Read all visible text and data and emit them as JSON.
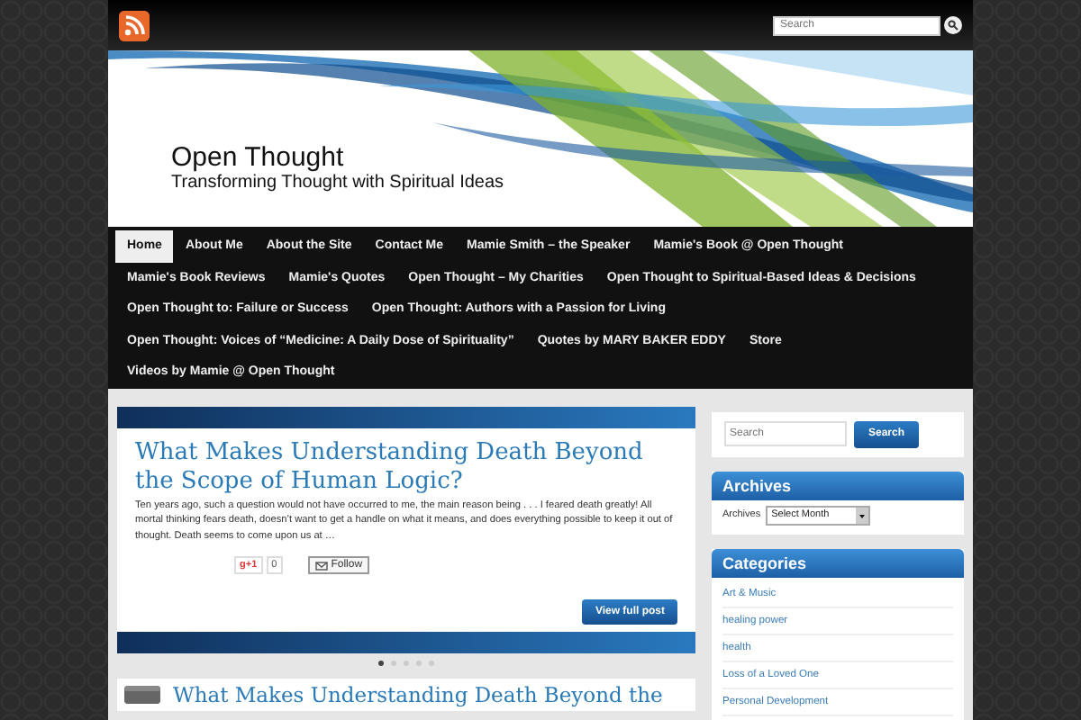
{
  "top_bar": {
    "search": {
      "placeholder": "Search"
    }
  },
  "header": {
    "title": "Open Thought",
    "tagline": "Transforming Thought with Spiritual Ideas"
  },
  "nav": [
    {
      "label": "Home",
      "selected": true
    },
    {
      "label": "About Me",
      "selected": false
    },
    {
      "label": "About the Site",
      "selected": false
    },
    {
      "label": "Contact Me",
      "selected": false
    },
    {
      "label": "Mamie Smith – the Speaker",
      "selected": false
    },
    {
      "label": "Mamie's Book @ Open Thought",
      "selected": false
    },
    {
      "label": "Mamie's Book Reviews",
      "selected": false
    },
    {
      "label": "Mamie's Quotes",
      "selected": false
    },
    {
      "label": "Open Thought – My Charities",
      "selected": false
    },
    {
      "label": "Open Thought to Spiritual-Based Ideas & Decisions",
      "selected": false
    },
    {
      "label": "Open Thought to: Failure or Success",
      "selected": false
    },
    {
      "label": "Open Thought: Authors with a Passion for Living",
      "selected": false
    },
    {
      "label": "Open Thought: Voices of “Medicine: A Daily Dose of Spirituality”",
      "selected": false
    },
    {
      "label": "Quotes by MARY BAKER EDDY",
      "selected": false
    },
    {
      "label": "Store",
      "selected": false
    },
    {
      "label": "Videos by Mamie @ Open Thought",
      "selected": false
    }
  ],
  "slider": {
    "post": {
      "title": "What Makes Understanding Death Beyond the Scope of Human Logic?",
      "excerpt": "Ten years ago, such a question would not have occurred to me, the main reason being . . .  I feared death greatly!  All mortal thinking fears death, doesn’t want to get a handle on what it means, and does everything possible to keep it out of thought.  Death seems to come upon us at …",
      "plus_one": "g+1",
      "plus_count": "0",
      "follow": "Follow",
      "read_more": "View full post"
    },
    "dots": [
      {
        "selected": true
      },
      {
        "selected": false
      },
      {
        "selected": false
      },
      {
        "selected": false
      },
      {
        "selected": false
      }
    ]
  },
  "next_post": {
    "title": "What Makes Understanding Death Beyond the"
  },
  "sidebar": {
    "search": {
      "placeholder": "Search",
      "button": "Search"
    },
    "archives": {
      "title": "Archives",
      "label": "Archives",
      "select": "Select Month"
    },
    "categories": {
      "title": "Categories",
      "items": [
        "Art & Music",
        "healing power",
        "health",
        "Loss of a Loved One",
        "Personal Development"
      ]
    }
  }
}
